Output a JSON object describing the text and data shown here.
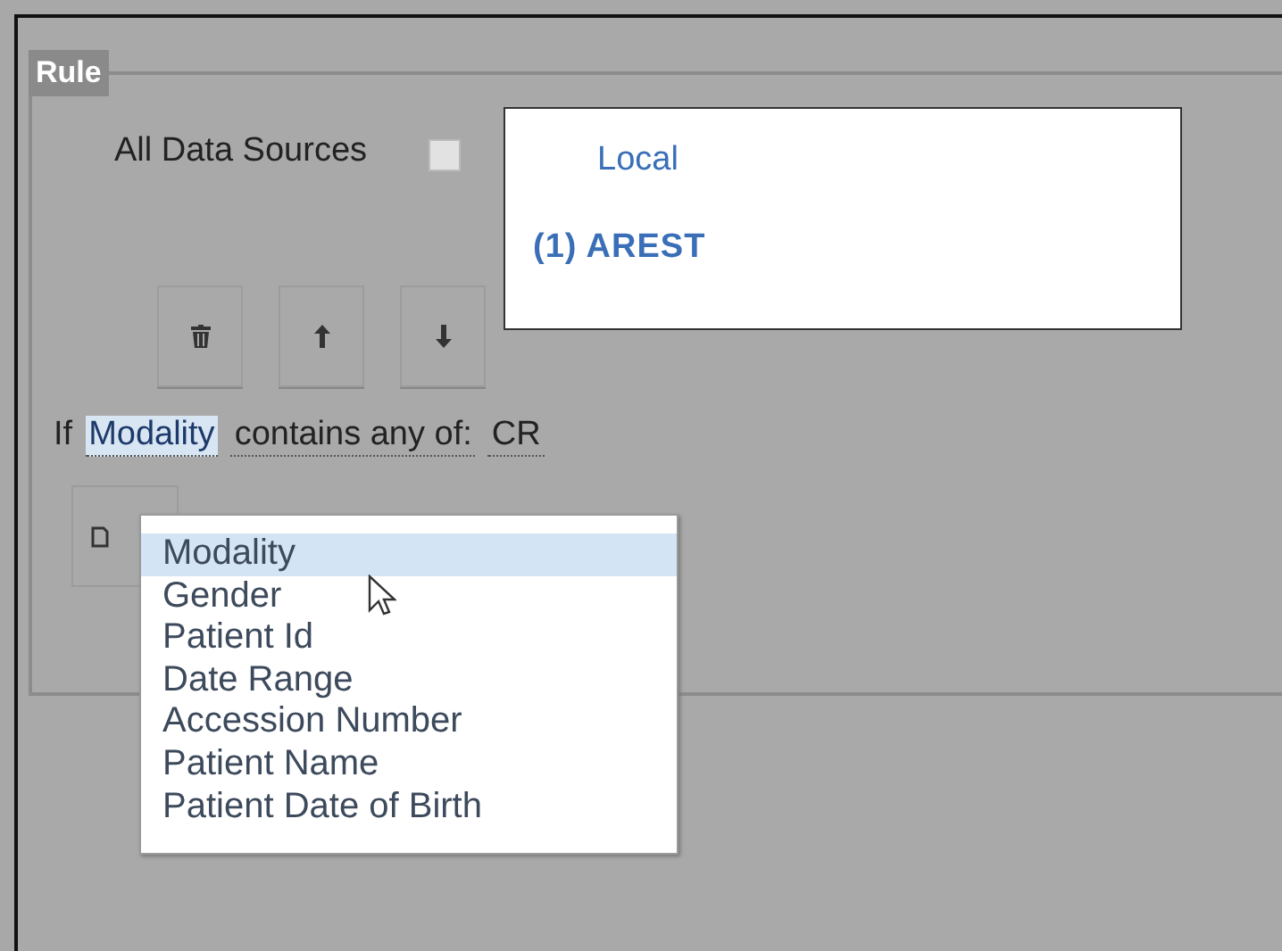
{
  "rule": {
    "legend": "Rule"
  },
  "all_data_sources": {
    "label": "All Data Sources",
    "checked": false
  },
  "sources": [
    {
      "kind": "group",
      "label": "Local",
      "selected": false
    },
    {
      "kind": "source",
      "label": "(1) AREST",
      "selected": true
    }
  ],
  "condition": {
    "prefix": "If",
    "field": "Modality",
    "field_active": true,
    "operator": "contains any of:",
    "value": "CR"
  },
  "field_menu": {
    "open": true,
    "options": [
      {
        "label": "Modality",
        "selected": true
      },
      {
        "label": "Gender",
        "selected": false
      },
      {
        "label": "Patient Id",
        "selected": false
      },
      {
        "label": "Date Range",
        "selected": false
      },
      {
        "label": "Accession Number",
        "selected": false
      },
      {
        "label": "Patient Name",
        "selected": false
      },
      {
        "label": "Patient Date of Birth",
        "selected": false
      }
    ]
  }
}
